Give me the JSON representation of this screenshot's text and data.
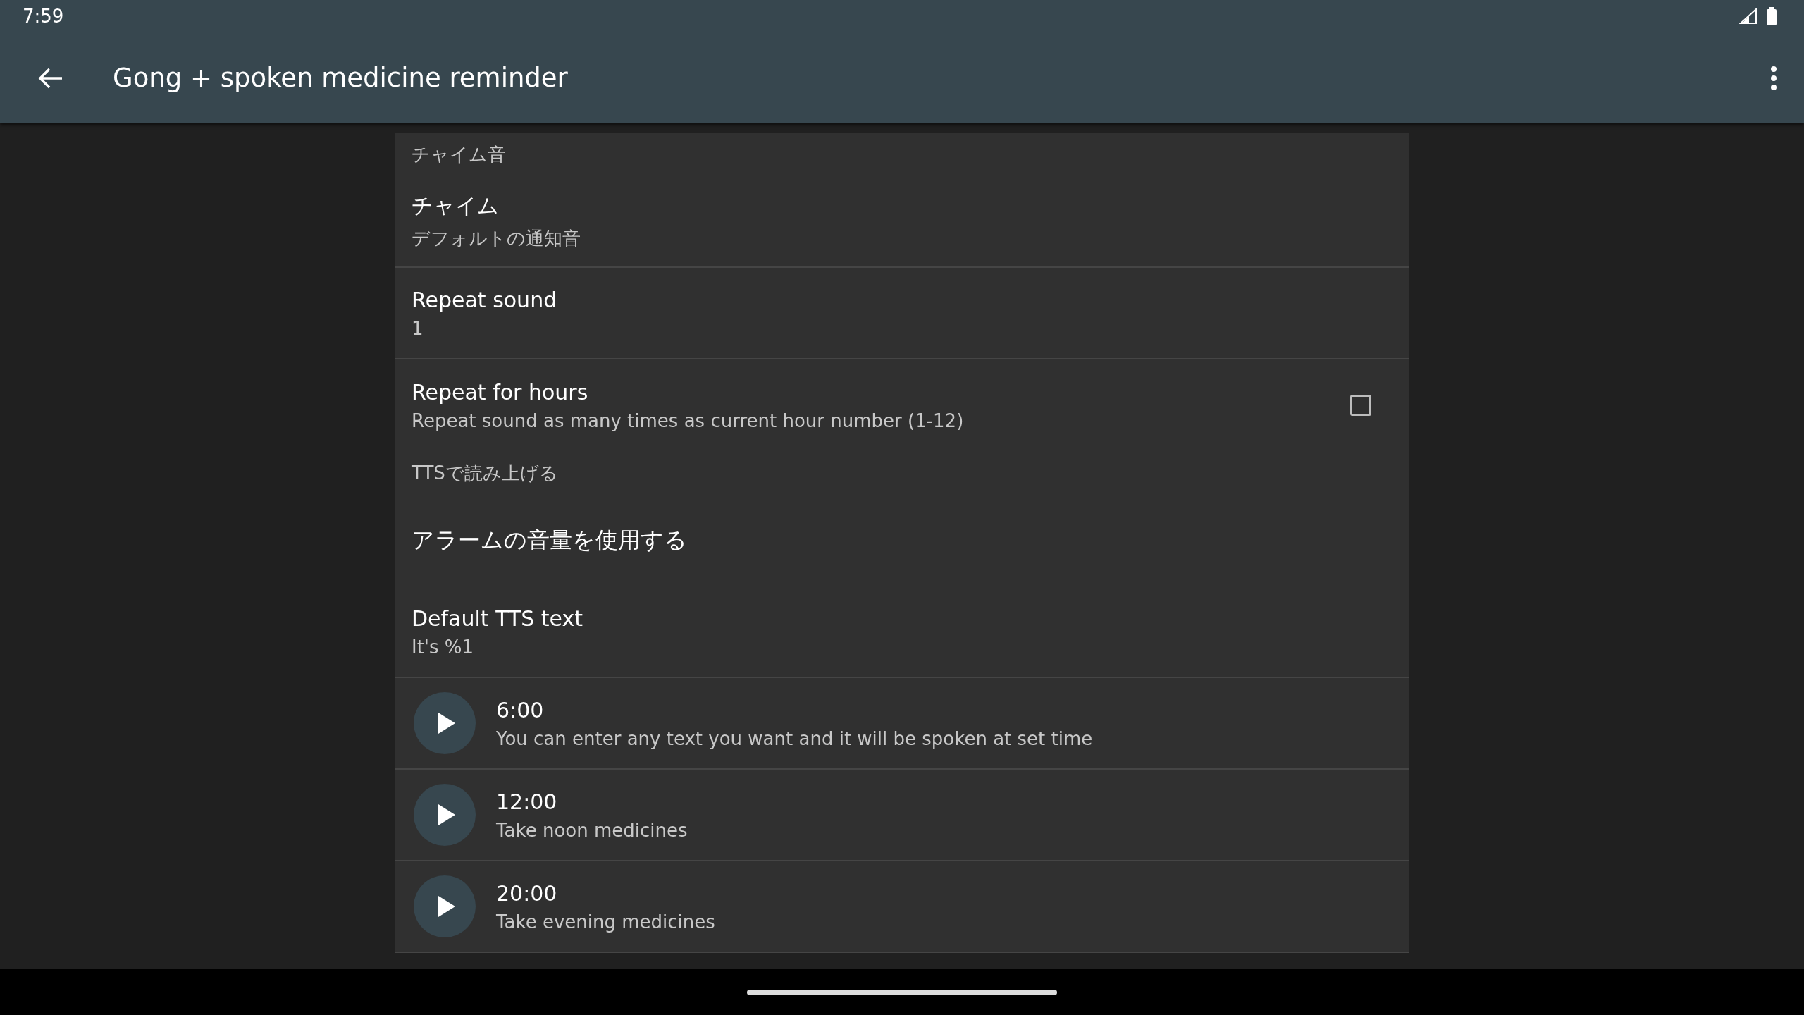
{
  "status_bar": {
    "time": "7:59"
  },
  "toolbar": {
    "title": "Gong + spoken medicine reminder"
  },
  "sections": [
    {
      "header": "チャイム音",
      "items": [
        {
          "kind": "pref",
          "title": "チャイム",
          "summary": "デフォルトの通知音",
          "divider": true
        },
        {
          "kind": "pref",
          "title": "Repeat sound",
          "summary": "1",
          "divider": true
        },
        {
          "kind": "checkbox",
          "title": "Repeat for hours",
          "summary": "Repeat sound as many times as current hour number (1-12)",
          "checked": false,
          "divider": false
        }
      ]
    },
    {
      "header": "TTSで読み上げる",
      "items": [
        {
          "kind": "pref",
          "title": "アラームの音量を使用する",
          "divider": false
        },
        {
          "kind": "pref",
          "title": "Default TTS text",
          "summary": "It's %1",
          "divider": true
        },
        {
          "kind": "entry",
          "title": "6:00",
          "summary": "You can enter any text you want and it will be spoken at set time",
          "divider": true
        },
        {
          "kind": "entry",
          "title": "12:00",
          "summary": "Take noon medicines",
          "divider": true
        },
        {
          "kind": "entry",
          "title": "20:00",
          "summary": "Take evening medicines",
          "divider": true
        }
      ]
    }
  ]
}
